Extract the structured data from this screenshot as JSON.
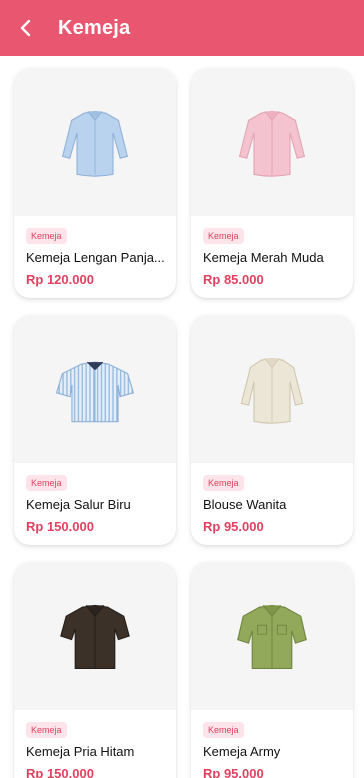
{
  "appbar": {
    "title": "Kemeja"
  },
  "products": [
    {
      "badge": "Kemeja",
      "name": "Kemeja Lengan Panja...",
      "price": "Rp 120.000",
      "image_icon": "blue-long-sleeve-shirt-icon"
    },
    {
      "badge": "Kemeja",
      "name": "Kemeja Merah Muda",
      "price": "Rp 85.000",
      "image_icon": "pink-long-sleeve-shirt-icon"
    },
    {
      "badge": "Kemeja",
      "name": "Kemeja Salur Biru",
      "price": "Rp 150.000",
      "image_icon": "striped-short-sleeve-shirt-icon"
    },
    {
      "badge": "Kemeja",
      "name": "Blouse Wanita",
      "price": "Rp 95.000",
      "image_icon": "cream-blouse-icon"
    },
    {
      "badge": "Kemeja",
      "name": "Kemeja Pria Hitam",
      "price": "Rp 150.000",
      "image_icon": "dark-brown-short-sleeve-shirt-icon"
    },
    {
      "badge": "Kemeja",
      "name": "Kemeja Army",
      "price": "Rp 95.000",
      "image_icon": "army-green-shirt-icon"
    }
  ],
  "colors": {
    "primary": "#e8566f",
    "accent": "#e0415f",
    "badge_bg": "#fde4ea"
  }
}
